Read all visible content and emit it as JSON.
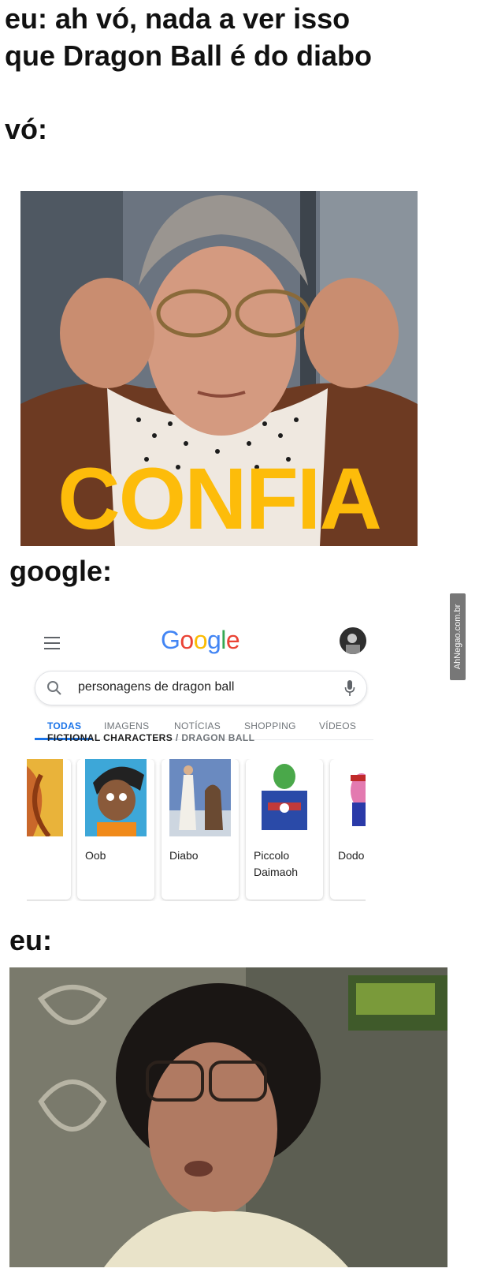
{
  "captions": {
    "line1": "eu: ah vó, nada a ver isso",
    "line2": "que Dragon Ball é do diabo",
    "vo": "vó:",
    "google": "google:",
    "eu": "eu:"
  },
  "confia_text": "CONFIA",
  "watermark": "AhNegao.com.br",
  "google_card": {
    "search_query": "personagens de dragon ball",
    "tabs": [
      "TODAS",
      "IMAGENS",
      "NOTÍCIAS",
      "SHOPPING",
      "VÍDEOS"
    ],
    "active_tab": "TODAS",
    "section_title": "FICTIONAL CHARACTERS",
    "section_sub": "DRAGON BALL",
    "characters": [
      {
        "name": ""
      },
      {
        "name": "Oob"
      },
      {
        "name": "Diabo"
      },
      {
        "name": "Piccolo Daimaoh"
      },
      {
        "name": "Dodo"
      }
    ]
  },
  "colors": {
    "confia": "#fdbc0a",
    "google_blue": "#4285f4",
    "google_red": "#ea4335",
    "google_yellow": "#fbbc05",
    "google_green": "#34a853",
    "active_tab": "#1a73e8"
  }
}
